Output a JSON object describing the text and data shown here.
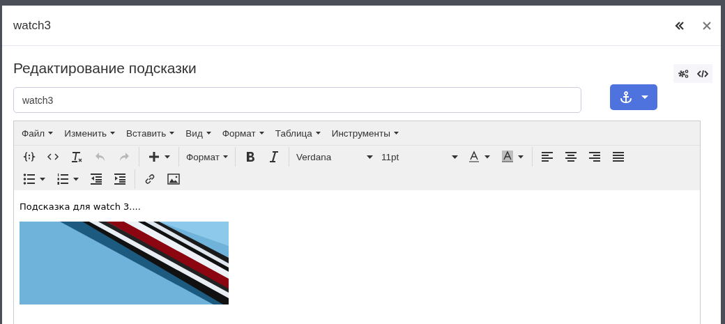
{
  "window": {
    "title": "watch3"
  },
  "heading": "Редактирование подсказки",
  "name_field": {
    "value": "watch3"
  },
  "menubar": [
    {
      "label": "Файл"
    },
    {
      "label": "Изменить"
    },
    {
      "label": "Вставить"
    },
    {
      "label": "Вид"
    },
    {
      "label": "Формат"
    },
    {
      "label": "Таблица"
    },
    {
      "label": "Инструменты"
    }
  ],
  "toolbar_rows": [
    [
      {
        "kind": "icon",
        "disabled": false
      },
      {
        "kind": "icon",
        "disabled": false
      },
      {
        "kind": "icon",
        "disabled": false
      },
      {
        "kind": "icon",
        "disabled": true
      },
      {
        "kind": "icon",
        "disabled": true
      },
      {
        "kind": "separator"
      },
      {
        "kind": "icon-menu",
        "disabled": false
      },
      {
        "kind": "separator"
      },
      {
        "kind": "menu",
        "label": "Формат"
      },
      {
        "kind": "separator"
      },
      {
        "kind": "icon",
        "disabled": false
      },
      {
        "kind": "icon",
        "disabled": false
      },
      {
        "kind": "separator"
      },
      {
        "kind": "select",
        "value": "Verdana"
      },
      {
        "kind": "select",
        "value": "11pt"
      },
      {
        "kind": "icon-menu",
        "disabled": false
      },
      {
        "kind": "icon-menu",
        "disabled": false
      },
      {
        "kind": "separator"
      },
      {
        "kind": "icon",
        "disabled": false
      },
      {
        "kind": "icon",
        "disabled": false
      },
      {
        "kind": "icon",
        "disabled": false
      },
      {
        "kind": "icon",
        "disabled": false
      }
    ],
    [
      {
        "kind": "icon-menu",
        "disabled": false
      },
      {
        "kind": "icon-menu",
        "disabled": false
      },
      {
        "kind": "icon",
        "disabled": false
      },
      {
        "kind": "icon",
        "disabled": false
      },
      {
        "kind": "separator"
      },
      {
        "kind": "icon",
        "disabled": false
      },
      {
        "kind": "icon",
        "disabled": false
      }
    ]
  ],
  "content": {
    "text": "Подсказка для watch 3...."
  }
}
